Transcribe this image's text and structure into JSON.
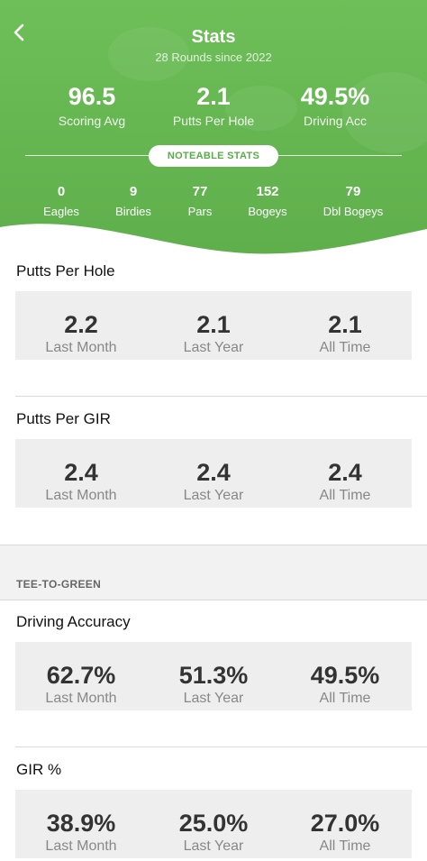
{
  "header": {
    "title": "Stats",
    "subtitle": "28 Rounds since 2022"
  },
  "main_stats": [
    {
      "value": "96.5",
      "label": "Scoring Avg"
    },
    {
      "value": "2.1",
      "label": "Putts Per Hole"
    },
    {
      "value": "49.5%",
      "label": "Driving Acc"
    }
  ],
  "noteable_label": "NOTEABLE STATS",
  "counts": [
    {
      "value": "0",
      "label": "Eagles"
    },
    {
      "value": "9",
      "label": "Birdies"
    },
    {
      "value": "77",
      "label": "Pars"
    },
    {
      "value": "152",
      "label": "Bogeys"
    },
    {
      "value": "79",
      "label": "Dbl Bogeys"
    }
  ],
  "putts_per_hole": {
    "title": "Putts Per Hole",
    "cells": [
      {
        "value": "2.2",
        "label": "Last Month"
      },
      {
        "value": "2.1",
        "label": "Last Year"
      },
      {
        "value": "2.1",
        "label": "All Time"
      }
    ]
  },
  "putts_per_gir": {
    "title": "Putts Per GIR",
    "cells": [
      {
        "value": "2.4",
        "label": "Last Month"
      },
      {
        "value": "2.4",
        "label": "Last Year"
      },
      {
        "value": "2.4",
        "label": "All Time"
      }
    ]
  },
  "section_label": "TEE-TO-GREEN",
  "driving_accuracy": {
    "title": "Driving Accuracy",
    "cells": [
      {
        "value": "62.7%",
        "label": "Last Month"
      },
      {
        "value": "51.3%",
        "label": "Last Year"
      },
      {
        "value": "49.5%",
        "label": "All Time"
      }
    ]
  },
  "gir": {
    "title": "GIR %",
    "cells": [
      {
        "value": "38.9%",
        "label": "Last Month"
      },
      {
        "value": "25.0%",
        "label": "Last Year"
      },
      {
        "value": "27.0%",
        "label": "All Time"
      }
    ]
  },
  "colors": {
    "brand_green": "#66b752",
    "pill_text": "#5aab49",
    "card_bg": "#eeeeee"
  },
  "icons": {
    "back": "chevron-left-icon"
  }
}
